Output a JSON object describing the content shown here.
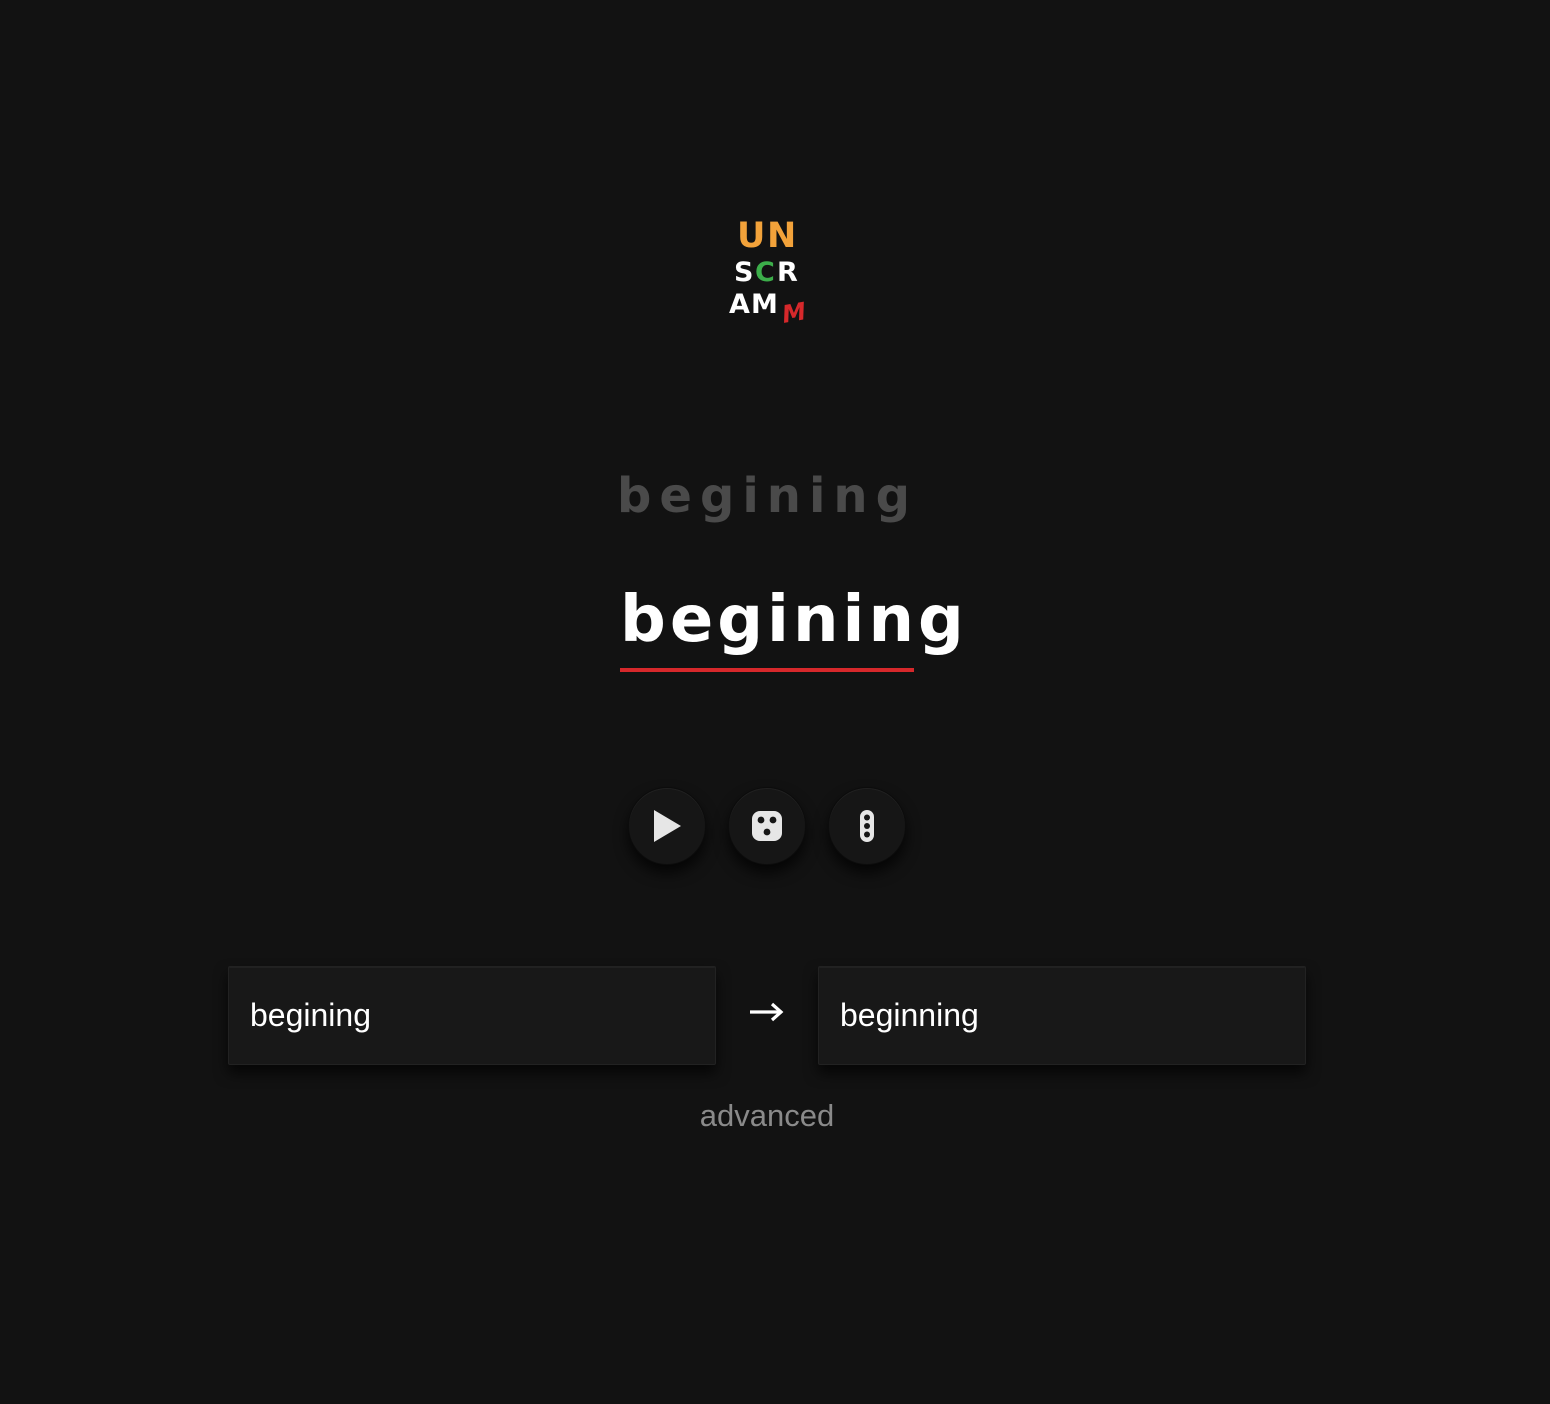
{
  "logo": {
    "letters": [
      "U",
      "N",
      "S",
      "C",
      "R",
      "A",
      "M",
      "M"
    ],
    "colors": {
      "orange": "#f2a23a",
      "white": "#ffffff",
      "green": "#3cae4a",
      "red": "#d6282b"
    }
  },
  "ghost_word": "begining",
  "main_word": "begining",
  "buttons": {
    "play_icon": "play-icon",
    "dice_icon": "dice-icon",
    "menu_icon": "dots-vertical-icon"
  },
  "fields": {
    "left_value": "begining",
    "right_value": "beginning"
  },
  "arrow_icon": "arrow-right-icon",
  "advanced_label": "advanced",
  "colors": {
    "background": "#121212",
    "ghost_text": "#4a4a4a",
    "underline": "#d6282b",
    "advanced_text": "#8a8a8a",
    "icon": "#e6e6e6"
  }
}
